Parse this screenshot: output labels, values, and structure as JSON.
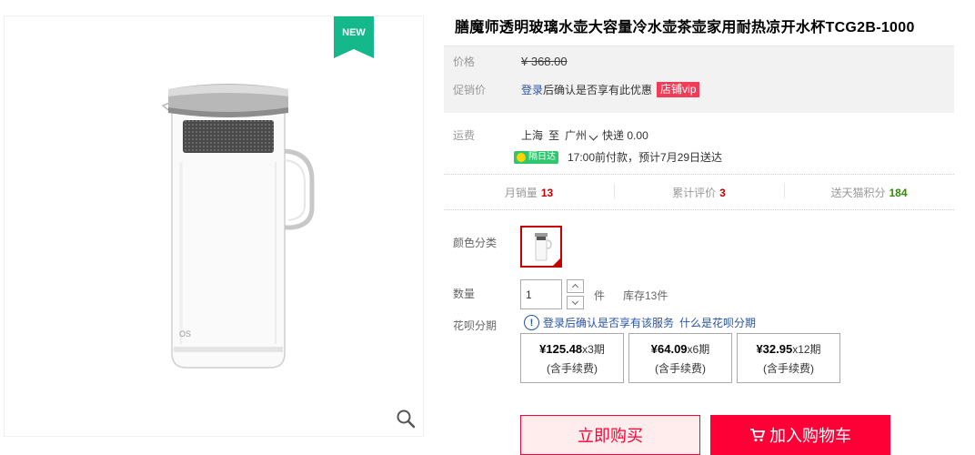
{
  "gallery": {
    "badge": "NEW",
    "image_alt": "glass pitcher",
    "logo": "OS",
    "zoom_icon": "magnifier-icon"
  },
  "product": {
    "title": "膳魔师透明玻璃水壶大容量冷水壶茶壶家用耐热凉开水杯TCG2B-1000"
  },
  "price": {
    "label": "价格",
    "original": "¥ 368.00",
    "promo_label": "促销价",
    "promo_login": "登录",
    "promo_text": "后确认是否享有此优惠",
    "vip_tag": "店铺vip"
  },
  "shipping": {
    "label": "运费",
    "from": "上海",
    "to_word": "至",
    "to": "广州",
    "method": "快递 0.00",
    "badge": "隔日达",
    "delivery": "17:00前付款，预计7月29日送达"
  },
  "stats": [
    {
      "label": "月销量",
      "value": "13"
    },
    {
      "label": "累计评价",
      "value": "3"
    },
    {
      "label": "送天猫积分",
      "value": "184"
    }
  ],
  "options": {
    "color_label": "颜色分类",
    "qty_label": "数量",
    "qty_value": "1",
    "unit": "件",
    "stock": "库存13件",
    "huabei_label": "花呗分期",
    "huabei_login": "登录后确认是否享有该服务",
    "huabei_what": "什么是花呗分期",
    "plans": [
      {
        "amount": "¥125.48",
        "periods": "x3期",
        "fee": "(含手续费)"
      },
      {
        "amount": "¥64.09",
        "periods": "x6期",
        "fee": "(含手续费)"
      },
      {
        "amount": "¥32.95",
        "periods": "x12期",
        "fee": "(含手续费)"
      }
    ]
  },
  "actions": {
    "buy_now": "立即购买",
    "add_cart": "加入购物车"
  },
  "colors": {
    "accent": "#ff0036",
    "badge_green": "#14b88a",
    "link": "#2953a6"
  }
}
